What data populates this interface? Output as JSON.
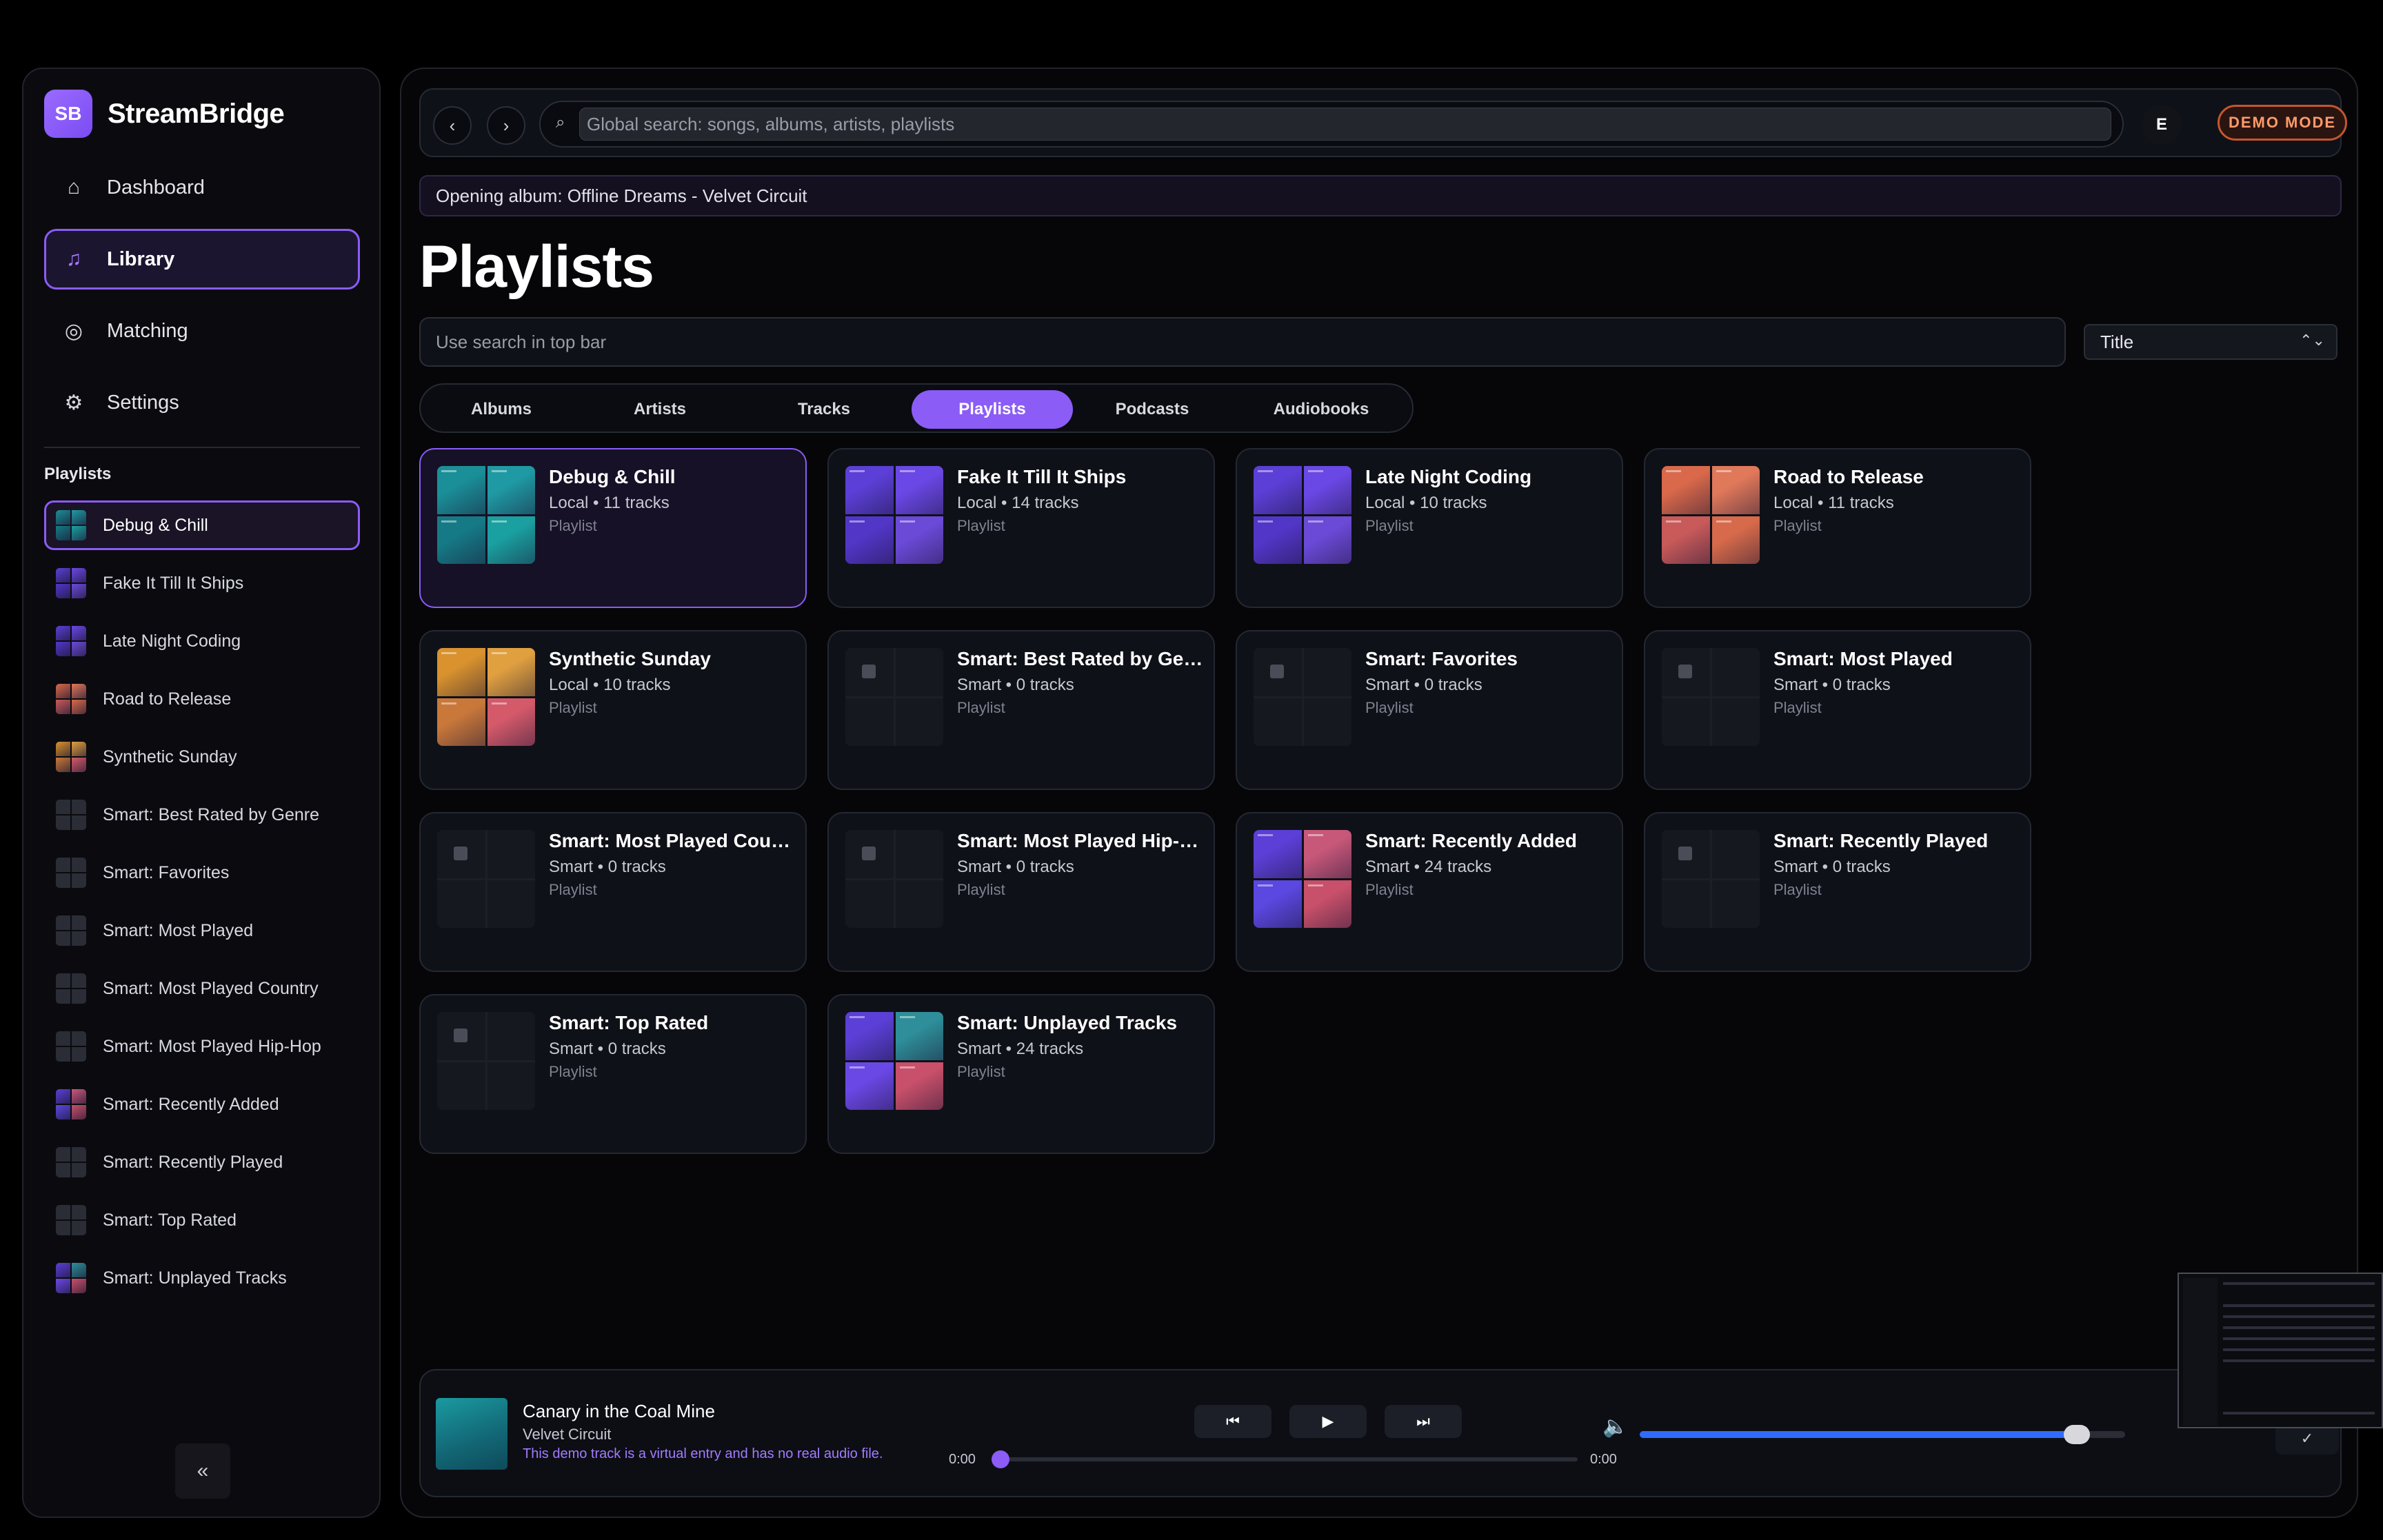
{
  "app": {
    "logo": "SB",
    "name": "StreamBridge"
  },
  "nav": [
    {
      "icon": "home-icon",
      "glyph": "⌂",
      "label": "Dashboard",
      "active": false
    },
    {
      "icon": "music-note-icon",
      "glyph": "♫",
      "label": "Library",
      "active": true
    },
    {
      "icon": "target-icon",
      "glyph": "◎",
      "label": "Matching",
      "active": false
    },
    {
      "icon": "gear-icon",
      "glyph": "⚙",
      "label": "Settings",
      "active": false
    }
  ],
  "sidebar": {
    "section_title": "Playlists",
    "collapse_label": "«",
    "playlists": [
      {
        "label": "Debug & Chill",
        "art": "teal",
        "active": true
      },
      {
        "label": "Fake It Till It Ships",
        "art": "violet"
      },
      {
        "label": "Late Night Coding",
        "art": "violet"
      },
      {
        "label": "Road to Release",
        "art": "coral"
      },
      {
        "label": "Synthetic Sunday",
        "art": "amber"
      },
      {
        "label": "Smart: Best Rated by Genre",
        "art": "empty"
      },
      {
        "label": "Smart: Favorites",
        "art": "empty"
      },
      {
        "label": "Smart: Most Played",
        "art": "empty"
      },
      {
        "label": "Smart: Most Played Country",
        "art": "empty"
      },
      {
        "label": "Smart: Most Played Hip-Hop",
        "art": "empty"
      },
      {
        "label": "Smart: Recently Added",
        "art": "mixed"
      },
      {
        "label": "Smart: Recently Played",
        "art": "empty"
      },
      {
        "label": "Smart: Top Rated",
        "art": "empty"
      },
      {
        "label": "Smart: Unplayed Tracks",
        "art": "mixed2"
      }
    ]
  },
  "topbar": {
    "back": "‹",
    "forward": "›",
    "search_icon": "⌕",
    "search_placeholder": "Global search: songs, albums, artists, playlists",
    "avatar": "E",
    "badge": "DEMO MODE"
  },
  "status_message": "Opening album: Offline Dreams - Velvet Circuit",
  "page_title": "Playlists",
  "filter_placeholder": "Use search in top bar",
  "sort": {
    "value": "Title",
    "chevron": "⌃⌄"
  },
  "tabs": [
    {
      "label": "Albums",
      "active": false
    },
    {
      "label": "Artists",
      "active": false
    },
    {
      "label": "Tracks",
      "active": false
    },
    {
      "label": "Playlists",
      "active": true
    },
    {
      "label": "Podcasts",
      "active": false
    },
    {
      "label": "Audiobooks",
      "active": false
    }
  ],
  "cards": [
    {
      "title": "Debug & Chill",
      "meta": "Local • 11 tracks",
      "type": "Playlist",
      "art": "teal",
      "active": true
    },
    {
      "title": "Fake It Till It Ships",
      "meta": "Local • 14 tracks",
      "type": "Playlist",
      "art": "violet"
    },
    {
      "title": "Late Night Coding",
      "meta": "Local • 10 tracks",
      "type": "Playlist",
      "art": "violet"
    },
    {
      "title": "Road to Release",
      "meta": "Local • 11 tracks",
      "type": "Playlist",
      "art": "coral"
    },
    {
      "title": "Synthetic Sunday",
      "meta": "Local • 10 tracks",
      "type": "Playlist",
      "art": "amber"
    },
    {
      "title": "Smart: Best Rated by Genre",
      "meta": "Smart • 0 tracks",
      "type": "Playlist",
      "art": "empty"
    },
    {
      "title": "Smart: Favorites",
      "meta": "Smart • 0 tracks",
      "type": "Playlist",
      "art": "empty"
    },
    {
      "title": "Smart: Most Played",
      "meta": "Smart • 0 tracks",
      "type": "Playlist",
      "art": "empty"
    },
    {
      "title": "Smart: Most Played Country",
      "meta": "Smart • 0 tracks",
      "type": "Playlist",
      "art": "empty"
    },
    {
      "title": "Smart: Most Played Hip-Hop",
      "meta": "Smart • 0 tracks",
      "type": "Playlist",
      "art": "empty"
    },
    {
      "title": "Smart: Recently Added",
      "meta": "Smart • 24 tracks",
      "type": "Playlist",
      "art": "mixed"
    },
    {
      "title": "Smart: Recently Played",
      "meta": "Smart • 0 tracks",
      "type": "Playlist",
      "art": "empty"
    },
    {
      "title": "Smart: Top Rated",
      "meta": "Smart • 0 tracks",
      "type": "Playlist",
      "art": "empty"
    },
    {
      "title": "Smart: Unplayed Tracks",
      "meta": "Smart • 24 tracks",
      "type": "Playlist",
      "art": "mixed2"
    }
  ],
  "art_palettes": {
    "teal": [
      "#1a8f98",
      "#1f9aa4",
      "#157a86",
      "#1aa0a0"
    ],
    "violet": [
      "#5b3fd6",
      "#6a48e6",
      "#5236c8",
      "#6b4ad8"
    ],
    "coral": [
      "#d9694a",
      "#e0785a",
      "#c85a5a",
      "#d66a4a"
    ],
    "amber": [
      "#d9922e",
      "#e0a040",
      "#c9783a",
      "#d45a6a"
    ],
    "mixed": [
      "#5b3fd6",
      "#c8587a",
      "#5a48e0",
      "#c8506a"
    ],
    "mixed2": [
      "#5b3fd6",
      "#2e8f9a",
      "#6a48e6",
      "#c8506a"
    ]
  },
  "player": {
    "title": "Canary in the Coal Mine",
    "artist": "Velvet Circuit",
    "note": "This demo track is a virtual entry and has no real audio file.",
    "prev": "⏮",
    "play": "▶",
    "next": "⏭",
    "time_current": "0:00",
    "time_total": "0:00",
    "progress": 0.0,
    "volume": 0.9,
    "volume_icon": "🔈",
    "extra": "✓"
  },
  "colors": {
    "accent": "#8b5cf6",
    "volume": "#2f6bff",
    "badge": "#c4562e"
  }
}
